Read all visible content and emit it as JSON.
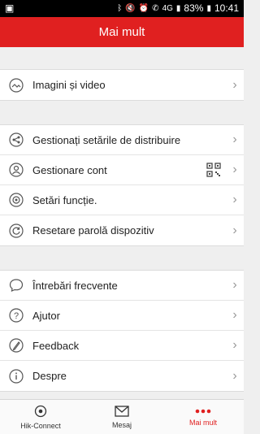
{
  "status_bar": {
    "battery": "83%",
    "time": "10:41",
    "network": "4G"
  },
  "header": {
    "title": "Mai mult"
  },
  "group1": [
    {
      "label": "Imagini și video",
      "icon": "image-icon"
    }
  ],
  "group2": [
    {
      "label": "Gestionați setările de distribuire",
      "icon": "share-icon"
    },
    {
      "label": "Gestionare cont",
      "icon": "user-icon"
    },
    {
      "label": "Setări funcție.",
      "icon": "settings-icon"
    },
    {
      "label": "Resetare parolă dispozitiv",
      "icon": "reset-icon"
    }
  ],
  "group3": [
    {
      "label": "Întrebări frecvente",
      "icon": "faq-icon"
    },
    {
      "label": "Ajutor",
      "icon": "help-icon"
    },
    {
      "label": "Feedback",
      "icon": "feedback-icon"
    },
    {
      "label": "Despre",
      "icon": "info-icon"
    }
  ],
  "tabs": [
    {
      "label": "Hik-Connect",
      "icon": "hik-connect-icon"
    },
    {
      "label": "Mesaj",
      "icon": "message-icon"
    },
    {
      "label": "Mai mult",
      "icon": "more-icon"
    }
  ],
  "colors": {
    "accent": "#e02020"
  }
}
